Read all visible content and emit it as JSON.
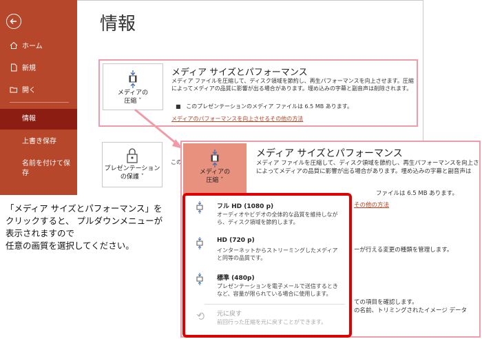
{
  "sidebar": {
    "items": [
      {
        "label": "ホーム",
        "icon": "home-icon"
      },
      {
        "label": "新規",
        "icon": "new-file-icon"
      },
      {
        "label": "開く",
        "icon": "open-folder-icon"
      }
    ],
    "selected": "情報",
    "sub_items": [
      "上書き保存",
      "名前を付けて保存"
    ]
  },
  "page": {
    "title": "情報"
  },
  "media_section": {
    "tile_label_1": "メディアの",
    "tile_label_2": "圧縮 ˇ",
    "title": "メディア サイズとパフォーマンス",
    "desc_line1": "メディア ファイルを圧縮して、ディスク領域を節約し、再生パフォーマンスを向上させます。圧縮",
    "desc_line2": "によってメディアの品質に影響が出る場合があります。埋め込みの字幕と副音声は削除されます。",
    "bullet": "このプレゼンテーションのメディア ファイルは 6.5 MB あります。",
    "link": "メディアのパフォーマンスを向上させるその他の方法"
  },
  "protect_section": {
    "tile_label_1": "プレゼンテーション",
    "tile_label_2": "の保護 ˇ",
    "partial": "この"
  },
  "inset": {
    "tile_label_1": "メディアの",
    "tile_label_2": "圧縮 ˇ",
    "title": "メディア サイズとパフォーマンス",
    "desc_line1": "メディア ファイルを圧縮して、ディスク領域を節約し、再生パフォーマンスを向上させ",
    "desc_line2": "によってメディアの品質に影響が出る場合があります。埋め込みの字幕と副音声は",
    "bullet_tail": "ファイルは 6.5 MB あります。",
    "link_tail": "その他の方法",
    "frag_1": "ーが行える変更の種類を管理します。",
    "frag_2": "ての項目を確認します。",
    "frag_3": "の名前、トリミングされたイメージ データ"
  },
  "dropdown": {
    "items": [
      {
        "title": "フル HD (1080 p)",
        "desc": "オーディオやビデオの全体的な品質を維持しながら、ディスク領域を節約します。"
      },
      {
        "title": "HD (720 p)",
        "desc": "インターネットからストリーミングしたメディアと同等の品質です。"
      },
      {
        "title": "標準 (480p)",
        "desc": "プレゼンテーションを電子メールで送信するときなど、容量が限られている場合に使用します。"
      },
      {
        "title": "元に戻す",
        "desc": "前回行った圧縮を元に戻すことができます。"
      }
    ]
  },
  "caption": {
    "line1": "「メディア サイズとパフォーマンス」を",
    "line2": "クリックすると、 プルダウンメニューが",
    "line3": "表示されますので",
    "line4": "任意の画質を選択してください。"
  },
  "colors": {
    "sidebar": "#b7472a",
    "selected": "#8c1d12",
    "highlight_border": "#f29aa8",
    "dropdown_border": "#e00000",
    "inset_tile": "#e9917f",
    "link": "#c14020"
  }
}
